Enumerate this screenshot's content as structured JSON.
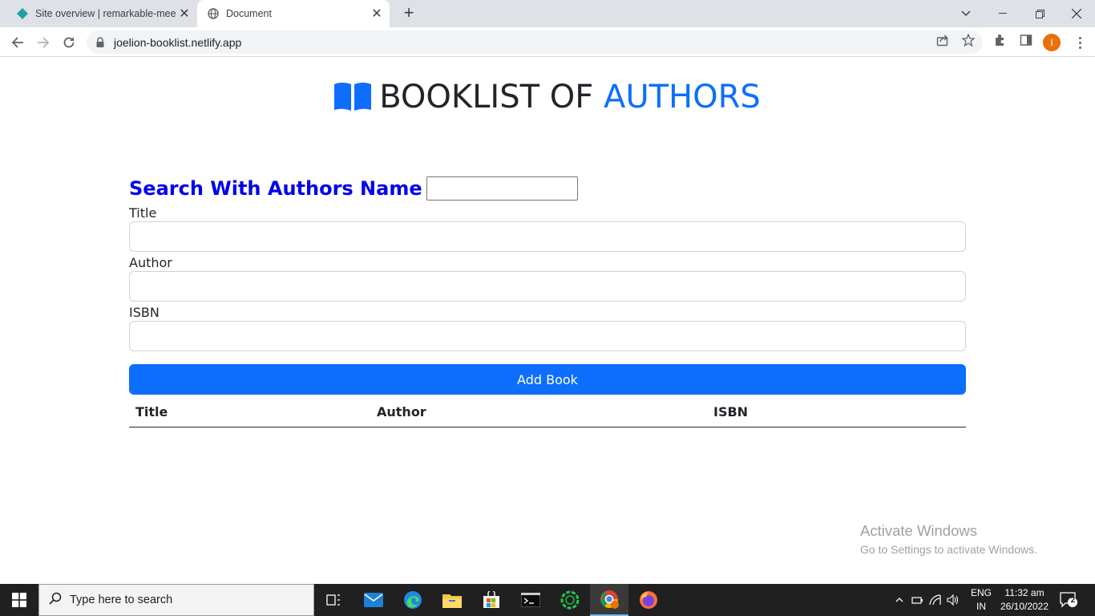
{
  "browser": {
    "tabs": [
      {
        "title": "Site overview | remarkable-meerk"
      },
      {
        "title": "Document"
      }
    ],
    "url": "joelion-booklist.netlify.app",
    "profile_initial": "I"
  },
  "page": {
    "heading_main": "BOOKLIST OF",
    "heading_accent": "AUTHORS",
    "search_label": "Search With Authors Name",
    "search_value": "",
    "fields": {
      "title_label": "Title",
      "author_label": "Author",
      "isbn_label": "ISBN"
    },
    "add_button": "Add Book",
    "table_headers": [
      "Title",
      "Author",
      "ISBN"
    ],
    "accent_color": "#0d6efd",
    "search_label_color": "#0000ee"
  },
  "watermark": {
    "line1": "Activate Windows",
    "line2": "Go to Settings to activate Windows."
  },
  "taskbar": {
    "search_placeholder": "Type here to search",
    "lang_top": "ENG",
    "lang_bottom": "IN",
    "time": "11:32 am",
    "date": "26/10/2022",
    "notification_count": "2"
  }
}
